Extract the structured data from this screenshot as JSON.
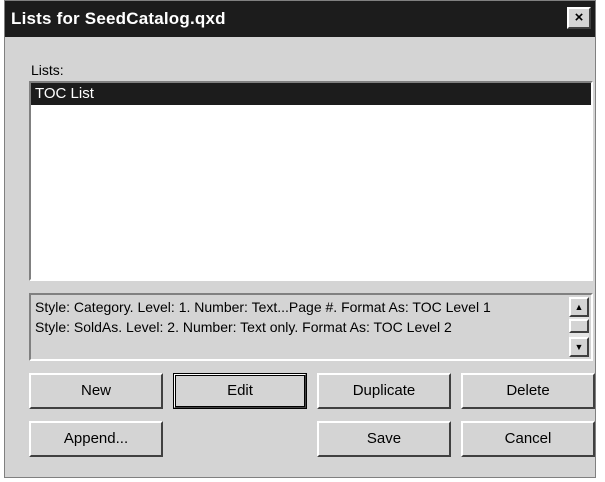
{
  "window": {
    "title": "Lists for SeedCatalog.qxd",
    "close_glyph": "×"
  },
  "lists_label": "Lists:",
  "lists": {
    "items": [
      {
        "label": "TOC List",
        "selected": true
      }
    ]
  },
  "description": {
    "lines": [
      "Style: Category. Level: 1. Number: Text...Page #. Format As: TOC Level 1",
      "Style: SoldAs. Level: 2. Number: Text only. Format As: TOC Level 2"
    ]
  },
  "buttons": {
    "new": "New",
    "edit": "Edit",
    "duplicate": "Duplicate",
    "delete": "Delete",
    "append": "Append...",
    "save": "Save",
    "cancel": "Cancel"
  },
  "icons": {
    "scroll_up": "up-arrow-icon",
    "scroll_down": "down-arrow-icon"
  }
}
